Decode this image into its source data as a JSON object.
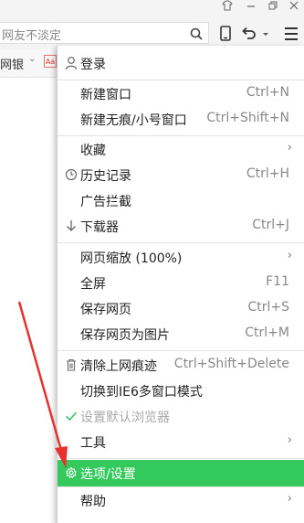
{
  "window": {
    "controls": [
      {
        "name": "skin-icon",
        "glyph": "👕"
      },
      {
        "name": "minimize-icon",
        "glyph": "—"
      },
      {
        "name": "restore-icon",
        "glyph": "❐"
      },
      {
        "name": "close-icon",
        "glyph": "✕"
      }
    ]
  },
  "toolbar": {
    "address_text": "网友不淡定",
    "icons": [
      "search-icon",
      "mobile-icon",
      "undo-icon",
      "dropdown-icon",
      "menu-icon"
    ]
  },
  "bookmarks": {
    "item_label": "网银",
    "chevron": "⌄",
    "aa_badge": "Aa"
  },
  "menu": {
    "login": {
      "icon": "user-icon",
      "label": "登录"
    },
    "group1": [
      {
        "label": "新建窗口",
        "shortcut": "Ctrl+N"
      },
      {
        "label": "新建无痕/小号窗口",
        "shortcut": "Ctrl+Shift+N"
      }
    ],
    "group2": [
      {
        "label": "收藏",
        "icon": "",
        "shortcut": "",
        "submenu": true
      },
      {
        "label": "历史记录",
        "icon": "clock-icon",
        "shortcut": "Ctrl+H",
        "submenu": false
      },
      {
        "label": "广告拦截",
        "icon": "",
        "shortcut": "",
        "submenu": false
      },
      {
        "label": "下载器",
        "icon": "download-icon",
        "shortcut": "Ctrl+J",
        "submenu": false
      }
    ],
    "group3": [
      {
        "label": "网页缩放 (100%)",
        "shortcut": "",
        "submenu": true
      },
      {
        "label": "全屏",
        "shortcut": "F11",
        "submenu": false
      },
      {
        "label": "保存网页",
        "shortcut": "Ctrl+S",
        "submenu": false
      },
      {
        "label": "保存网页为图片",
        "shortcut": "Ctrl+M",
        "submenu": false
      }
    ],
    "group4": [
      {
        "label": "清除上网痕迹",
        "icon": "trash-icon",
        "shortcut": "Ctrl+Shift+Delete",
        "submenu": false,
        "disabled": false
      },
      {
        "label": "切换到IE6多窗口模式",
        "icon": "",
        "shortcut": "",
        "submenu": false,
        "disabled": false
      },
      {
        "label": "设置默认浏览器",
        "icon": "check-icon",
        "shortcut": "",
        "submenu": false,
        "disabled": true
      },
      {
        "label": "工具",
        "icon": "",
        "shortcut": "",
        "submenu": true,
        "disabled": false
      },
      {
        "label": "选项/设置",
        "icon": "gear-icon",
        "shortcut": "",
        "submenu": false,
        "highlighted": true
      },
      {
        "label": "帮助",
        "icon": "",
        "shortcut": "",
        "submenu": true,
        "disabled": false
      }
    ],
    "colors": {
      "highlight": "#34c95d",
      "annotation_arrow": "#e8312f"
    }
  }
}
